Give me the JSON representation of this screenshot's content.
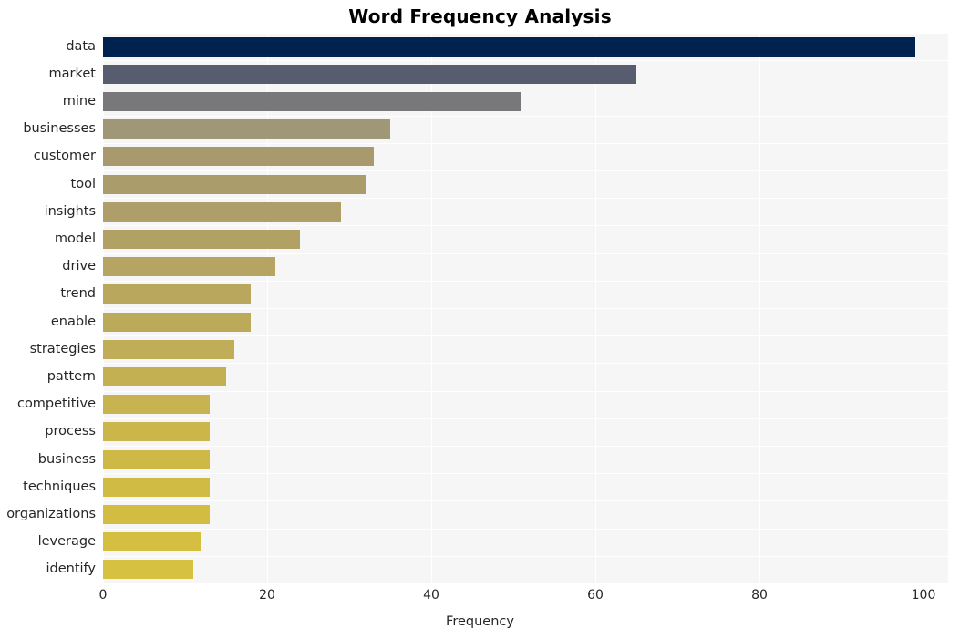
{
  "chart_data": {
    "type": "bar",
    "orientation": "horizontal",
    "title": "Word Frequency Analysis",
    "xlabel": "Frequency",
    "ylabel": "",
    "xlim": [
      0,
      103
    ],
    "xticks": [
      0,
      20,
      40,
      60,
      80,
      100
    ],
    "xtick_labels": [
      "0",
      "20",
      "40",
      "60",
      "80",
      "100"
    ],
    "grid": true,
    "grid_axis": "both",
    "grid_color": "#ffffff",
    "plot_background": "#f6f6f6",
    "figure_background": "#ffffff",
    "legend": "none",
    "colormap": "cividis",
    "categories": [
      "data",
      "market",
      "mine",
      "businesses",
      "customer",
      "tool",
      "insights",
      "model",
      "drive",
      "trend",
      "enable",
      "strategies",
      "pattern",
      "competitive",
      "process",
      "business",
      "techniques",
      "organizations",
      "leverage",
      "identify"
    ],
    "values": [
      99,
      65,
      51,
      35,
      33,
      32,
      29,
      24,
      21,
      18,
      18,
      16,
      15,
      13,
      13,
      13,
      13,
      13,
      12,
      11
    ],
    "bar_colors": [
      "#00224e",
      "#575c6e",
      "#78787a",
      "#9f9775",
      "#a89a6d",
      "#ab9c6b",
      "#ae9e69",
      "#b2a165",
      "#b5a462",
      "#b9a75e",
      "#bcaa5b",
      "#c0ad57",
      "#c3b053",
      "#c7b34f",
      "#cab64b",
      "#ceb946",
      "#d0bb44",
      "#d2bd42",
      "#d4bf41",
      "#d6c140"
    ]
  }
}
